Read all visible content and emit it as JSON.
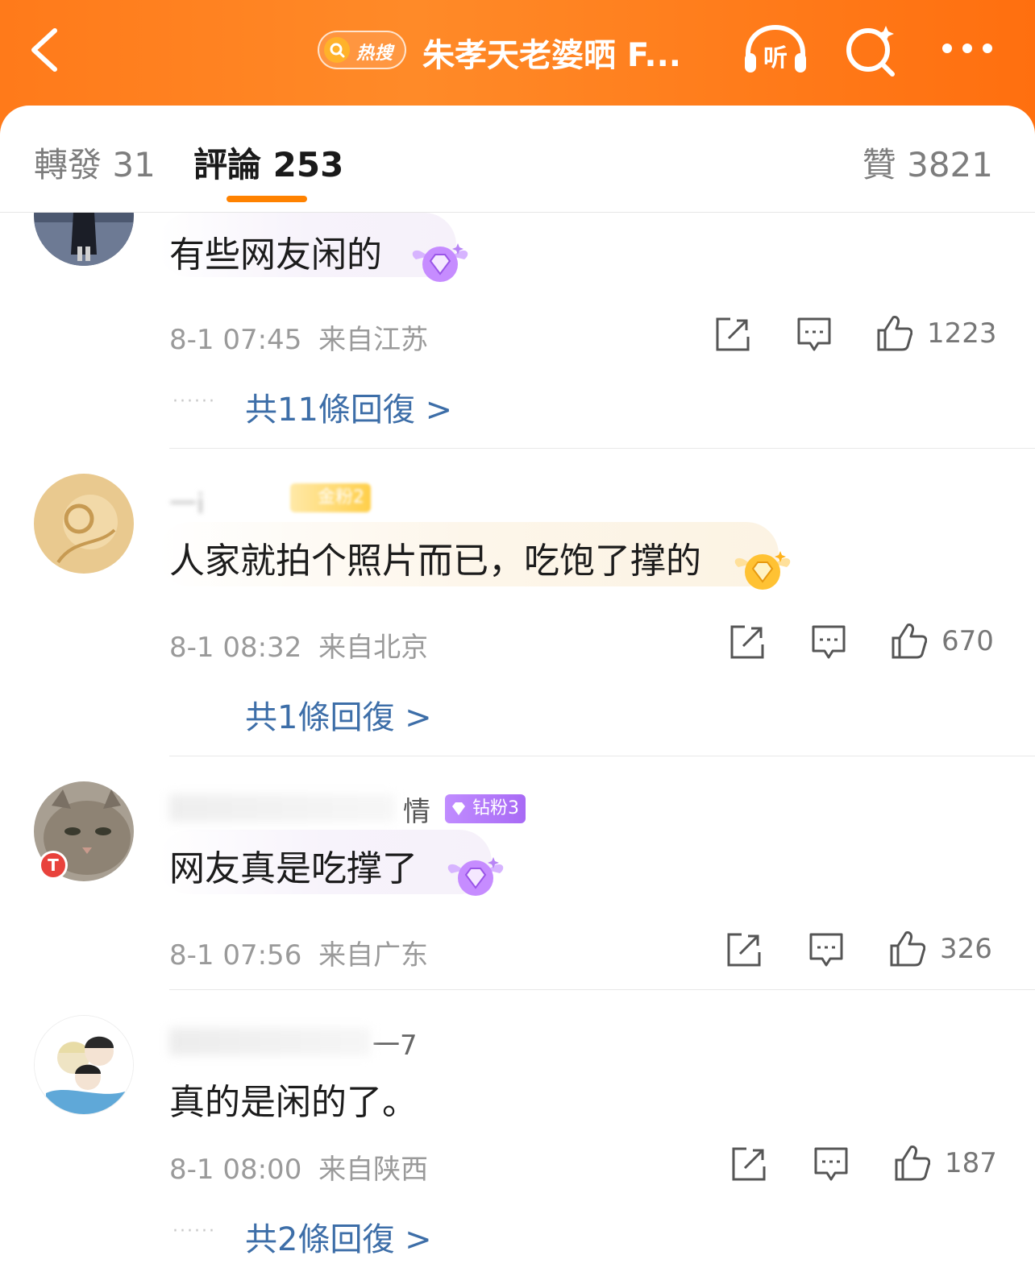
{
  "header": {
    "hot_search_label": "热搜",
    "title": "朱孝天老婆晒 F...",
    "listen_label": "听",
    "colors": {
      "background": "#ff7a1a",
      "foreground": "#ffffff"
    }
  },
  "tabs": [
    {
      "label": "轉發",
      "count": "31"
    },
    {
      "label": "評論",
      "count": "253"
    },
    {
      "label": "贊",
      "count": "3821"
    }
  ],
  "comments": [
    {
      "username": "",
      "text": "有些网友闲的",
      "time": "8-1 07:45",
      "location": "来自江苏",
      "likes": "1223",
      "replies": "共11條回復 >",
      "badge_color": "#b06cf0"
    },
    {
      "username": "一i",
      "fan_badge": "金粉2",
      "text": "人家就拍个照片而已，吃饱了撑的",
      "time": "8-1 08:32",
      "location": "来自北京",
      "likes": "670",
      "replies": "共1條回復 >",
      "badge_color": "#ffb21c"
    },
    {
      "username": "情",
      "fan_badge": "钻粉3",
      "text": "网友真是吃撑了",
      "time": "8-1 07:56",
      "location": "来自广东",
      "likes": "326",
      "badge_color": "#b06cf0"
    },
    {
      "username": "一7",
      "text": "真的是闲的了。",
      "time": "8-1 08:00",
      "location": "来自陕西",
      "likes": "187",
      "replies": "共2條回復 >"
    }
  ]
}
